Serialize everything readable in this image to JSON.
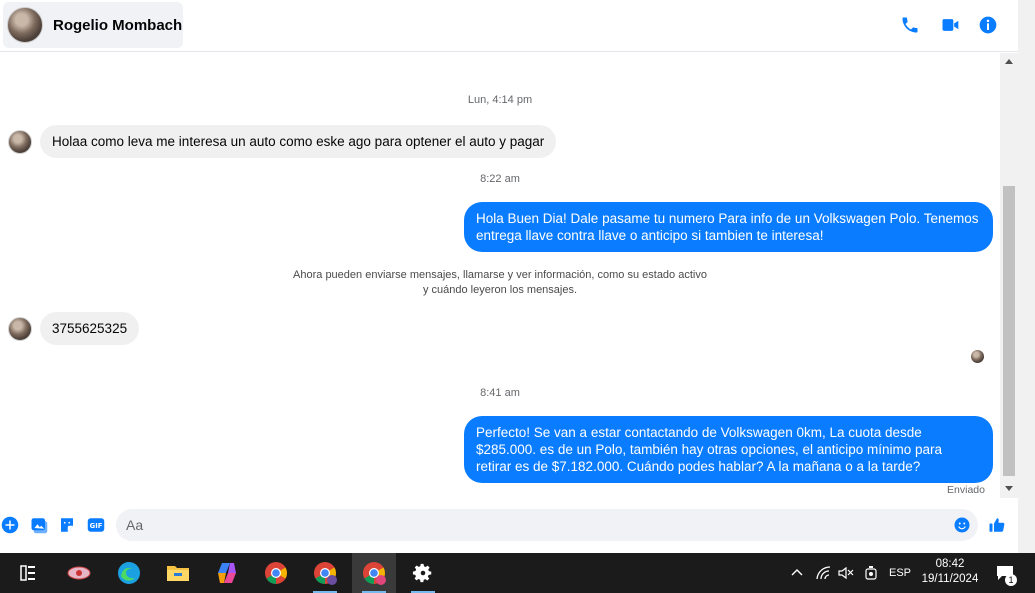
{
  "header": {
    "contact_name": "Rogelio Mombach",
    "icons": [
      "phone-icon",
      "video-call-icon",
      "info-icon"
    ]
  },
  "colors": {
    "accent": "#0a7cff",
    "incoming_bubble": "#f0f0f0",
    "taskbar": "#1b1b1b"
  },
  "messages": {
    "ts1": "Lun, 4:14 pm",
    "m1": "Holaa como leva  me interesa un auto como eske ago para optener el auto y pagar",
    "ts2": "8:22 am",
    "m2": "Hola Buen Dia! Dale pasame tu numero Para info de un Volkswagen Polo. Tenemos entrega llave contra llave o anticipo si tambien te interesa!",
    "notice_line1": "Ahora pueden enviarse mensajes, llamarse y ver información, como su estado activo",
    "notice_line2": "y cuándo leyeron los mensajes.",
    "m3": "3755625325",
    "ts3": "8:41 am",
    "m4": "Perfecto!  Se van a estar contactando de Volkswagen 0km, La cuota desde $285.000. es de un Polo, también hay otras opciones, el anticipo mínimo para retirar es de $7.182.000. Cuándo podes hablar? A la mañana o a la tarde?",
    "status": "Enviado"
  },
  "composer": {
    "placeholder": "Aa",
    "icons": [
      "add-icon",
      "image-icon",
      "sticker-icon",
      "gif-icon",
      "emoji-icon",
      "thumbs-up-icon"
    ]
  },
  "taskbar": {
    "lang": "ESP",
    "time": "08:42",
    "date": "19/11/2024",
    "notifications": "1"
  }
}
